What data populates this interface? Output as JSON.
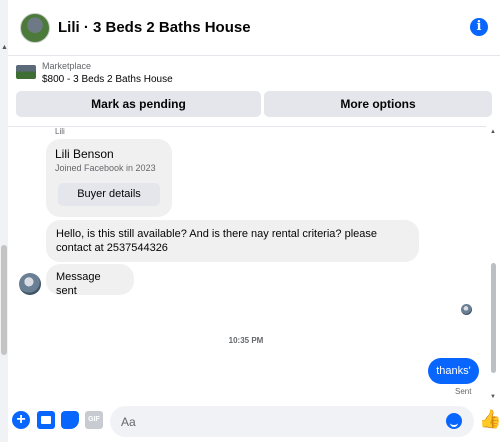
{
  "header": {
    "title": "Lili · 3 Beds 2 Baths House"
  },
  "marketplace": {
    "label": "Marketplace",
    "price_title": "$800 - 3 Beds 2 Baths House",
    "buttons": {
      "pending": "Mark as pending",
      "more": "More options"
    }
  },
  "messages": {
    "sender_label": "Lili",
    "card": {
      "name": "Lili Benson",
      "joined": "Joined Facebook in 2023",
      "button": "Buyer details"
    },
    "incoming": [
      "Hello, is this still available? And is there nay rental criteria? please contact at 2537544326",
      "Message sent"
    ],
    "timestamp": "10:35 PM",
    "outgoing": "thanks'",
    "status": "Sent"
  },
  "composer": {
    "placeholder": "Aa",
    "gif_label": "GIF"
  },
  "icons": [
    "info-icon",
    "plus-icon",
    "photo-icon",
    "sticker-icon",
    "gif-icon",
    "emoji-icon",
    "like-icon"
  ],
  "colors": {
    "accent": "#0866ff",
    "bubble_in": "#f0f0f0",
    "button_bg": "#e4e6eb"
  }
}
